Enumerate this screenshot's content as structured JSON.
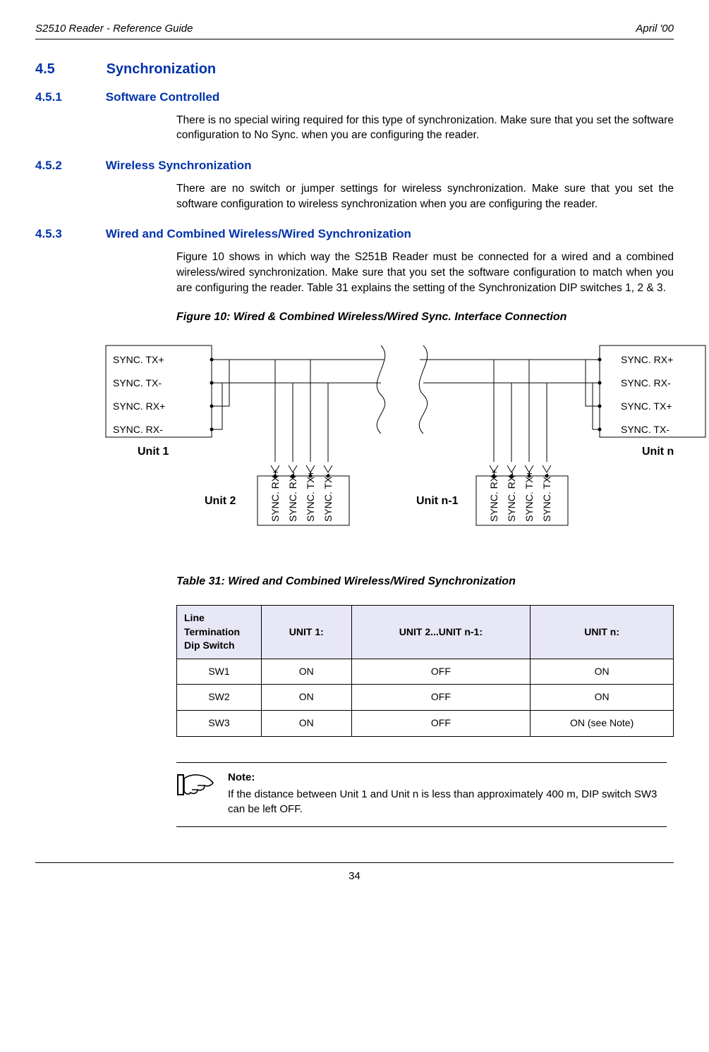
{
  "header": {
    "left": "S2510 Reader - Reference Guide",
    "right": "April '00"
  },
  "sections": {
    "s45": {
      "num": "4.5",
      "title": "Synchronization"
    },
    "s451": {
      "num": "4.5.1",
      "title": "Software Controlled",
      "para": "There is no special wiring required for this type of synchronization. Make sure that you set the software configuration to No Sync. when you are configuring the reader."
    },
    "s452": {
      "num": "4.5.2",
      "title": "Wireless Synchronization",
      "para": "There are no switch or jumper settings for wireless synchronization. Make sure that you set the software configuration to wireless synchronization when you are configuring the reader."
    },
    "s453": {
      "num": "4.5.3",
      "title": "Wired and Combined Wireless/Wired Synchronization",
      "para": "Figure 10 shows in which way the S251B Reader must be connected for a wired and a combined wireless/wired synchronization. Make sure that you set the software configuration to match when you are configuring the reader. Table 31 explains the setting of the Synchronization DIP switches 1, 2 & 3."
    }
  },
  "figure": {
    "caption": "Figure 10: Wired & Combined Wireless/Wired Sync. Interface Connection",
    "unit1": {
      "label": "Unit 1",
      "p1": "SYNC. TX+",
      "p2": "SYNC. TX-",
      "p3": "SYNC. RX+",
      "p4": "SYNC. RX-"
    },
    "unit2": {
      "label": "Unit 2",
      "p1": "SYNC. RX+",
      "p2": "SYNC. RX-",
      "p3": "SYNC. TX+",
      "p4": "SYNC. TX-"
    },
    "unitn1": {
      "label": "Unit n-1",
      "p1": "SYNC. RX+",
      "p2": "SYNC. RX-",
      "p3": "SYNC. TX+",
      "p4": "SYNC. TX-"
    },
    "unitn": {
      "label": "Unit n",
      "p1": "SYNC. RX+",
      "p2": "SYNC. RX-",
      "p3": "SYNC. TX+",
      "p4": "SYNC. TX-"
    }
  },
  "table": {
    "caption": "Table 31: Wired and Combined Wireless/Wired Synchronization",
    "headers": {
      "c0": "Line Termination Dip Switch",
      "c1": "UNIT 1:",
      "c2": "UNIT 2...UNIT n-1:",
      "c3": "UNIT n:"
    },
    "rows": [
      {
        "c0": "SW1",
        "c1": "ON",
        "c2": "OFF",
        "c3": "ON"
      },
      {
        "c0": "SW2",
        "c1": "ON",
        "c2": "OFF",
        "c3": "ON"
      },
      {
        "c0": "SW3",
        "c1": "ON",
        "c2": "OFF",
        "c3": "ON (see Note)"
      }
    ]
  },
  "note": {
    "label": "Note:",
    "text": "If the distance between Unit 1 and Unit n is less than approximately 400 m, DIP switch SW3 can be left OFF."
  },
  "footer": {
    "page": "34"
  }
}
